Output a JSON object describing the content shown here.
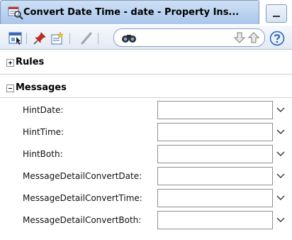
{
  "window": {
    "title": "Convert Date Time - date - Property Ins..."
  },
  "toolbar": {
    "buttons": [
      "select-node-icon",
      "pin-icon",
      "edit-properties-icon",
      "pencil-icon",
      "binoculars-icon"
    ],
    "search": {
      "value": ""
    },
    "nav": [
      "arrow-down-icon",
      "arrow-up-icon",
      "help-icon"
    ]
  },
  "sections": {
    "rules": {
      "label": "Rules",
      "expanded": false
    },
    "messages": {
      "label": "Messages",
      "expanded": true
    }
  },
  "messages": {
    "rows": [
      {
        "label": "HintDate:",
        "value": ""
      },
      {
        "label": "HintTime:",
        "value": ""
      },
      {
        "label": "HintBoth:",
        "value": ""
      },
      {
        "label": "MessageDetailConvertDate:",
        "value": ""
      },
      {
        "label": "MessageDetailConvertTime:",
        "value": ""
      },
      {
        "label": "MessageDetailConvertBoth:",
        "value": ""
      }
    ]
  },
  "colors": {
    "tab_bg": "#b9d1f0",
    "toolbar_bg": "#e9eef7",
    "help_blue": "#1f5fbf"
  }
}
